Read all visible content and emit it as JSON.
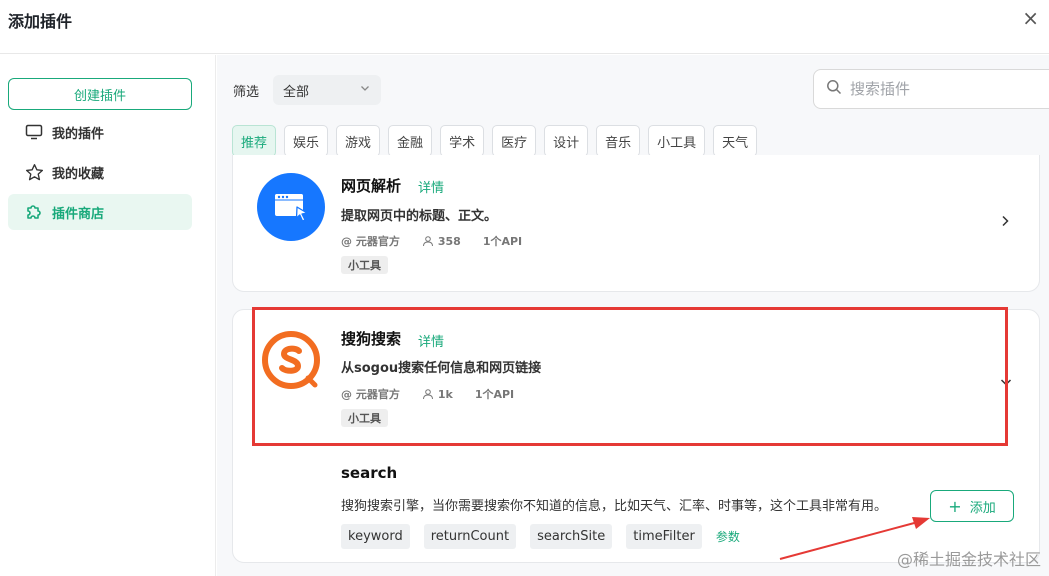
{
  "header": {
    "title": "添加插件",
    "close": "×"
  },
  "sidebar": {
    "create_label": "创建插件",
    "items": [
      {
        "label": "我的插件",
        "icon": "monitor-icon"
      },
      {
        "label": "我的收藏",
        "icon": "star-icon"
      },
      {
        "label": "插件商店",
        "icon": "puzzle-icon",
        "active": true
      }
    ]
  },
  "filter": {
    "label": "筛选",
    "selected": "全部"
  },
  "search": {
    "placeholder": "搜索插件"
  },
  "tabs": [
    "推荐",
    "娱乐",
    "游戏",
    "金融",
    "学术",
    "医疗",
    "设计",
    "音乐",
    "小工具",
    "天气"
  ],
  "plugins": [
    {
      "name": "网页解析",
      "detail": "详情",
      "desc": "提取网页中的标题、正文。",
      "author": "@ 元器官方",
      "users": "358",
      "apis": "1个API",
      "tag": "小工具"
    },
    {
      "name": "搜狗搜索",
      "detail": "详情",
      "desc": "从sogou搜索任何信息和网页链接",
      "author": "@ 元器官方",
      "users": "1k",
      "apis": "1个API",
      "tag": "小工具",
      "api": {
        "name": "search",
        "desc": "搜狗搜索引擎，当你需要搜索你不知道的信息，比如天气、汇率、时事等，这个工具非常有用。",
        "params": [
          "keyword",
          "returnCount",
          "searchSite",
          "timeFilter"
        ],
        "params_link": "参数",
        "add_label": "添加"
      }
    }
  ],
  "watermark": "@稀土掘金技术社区",
  "colors": {
    "accent": "#19a97b",
    "highlight": "#e53935",
    "sogou": "#f26d21",
    "webparse": "#1677ff"
  }
}
